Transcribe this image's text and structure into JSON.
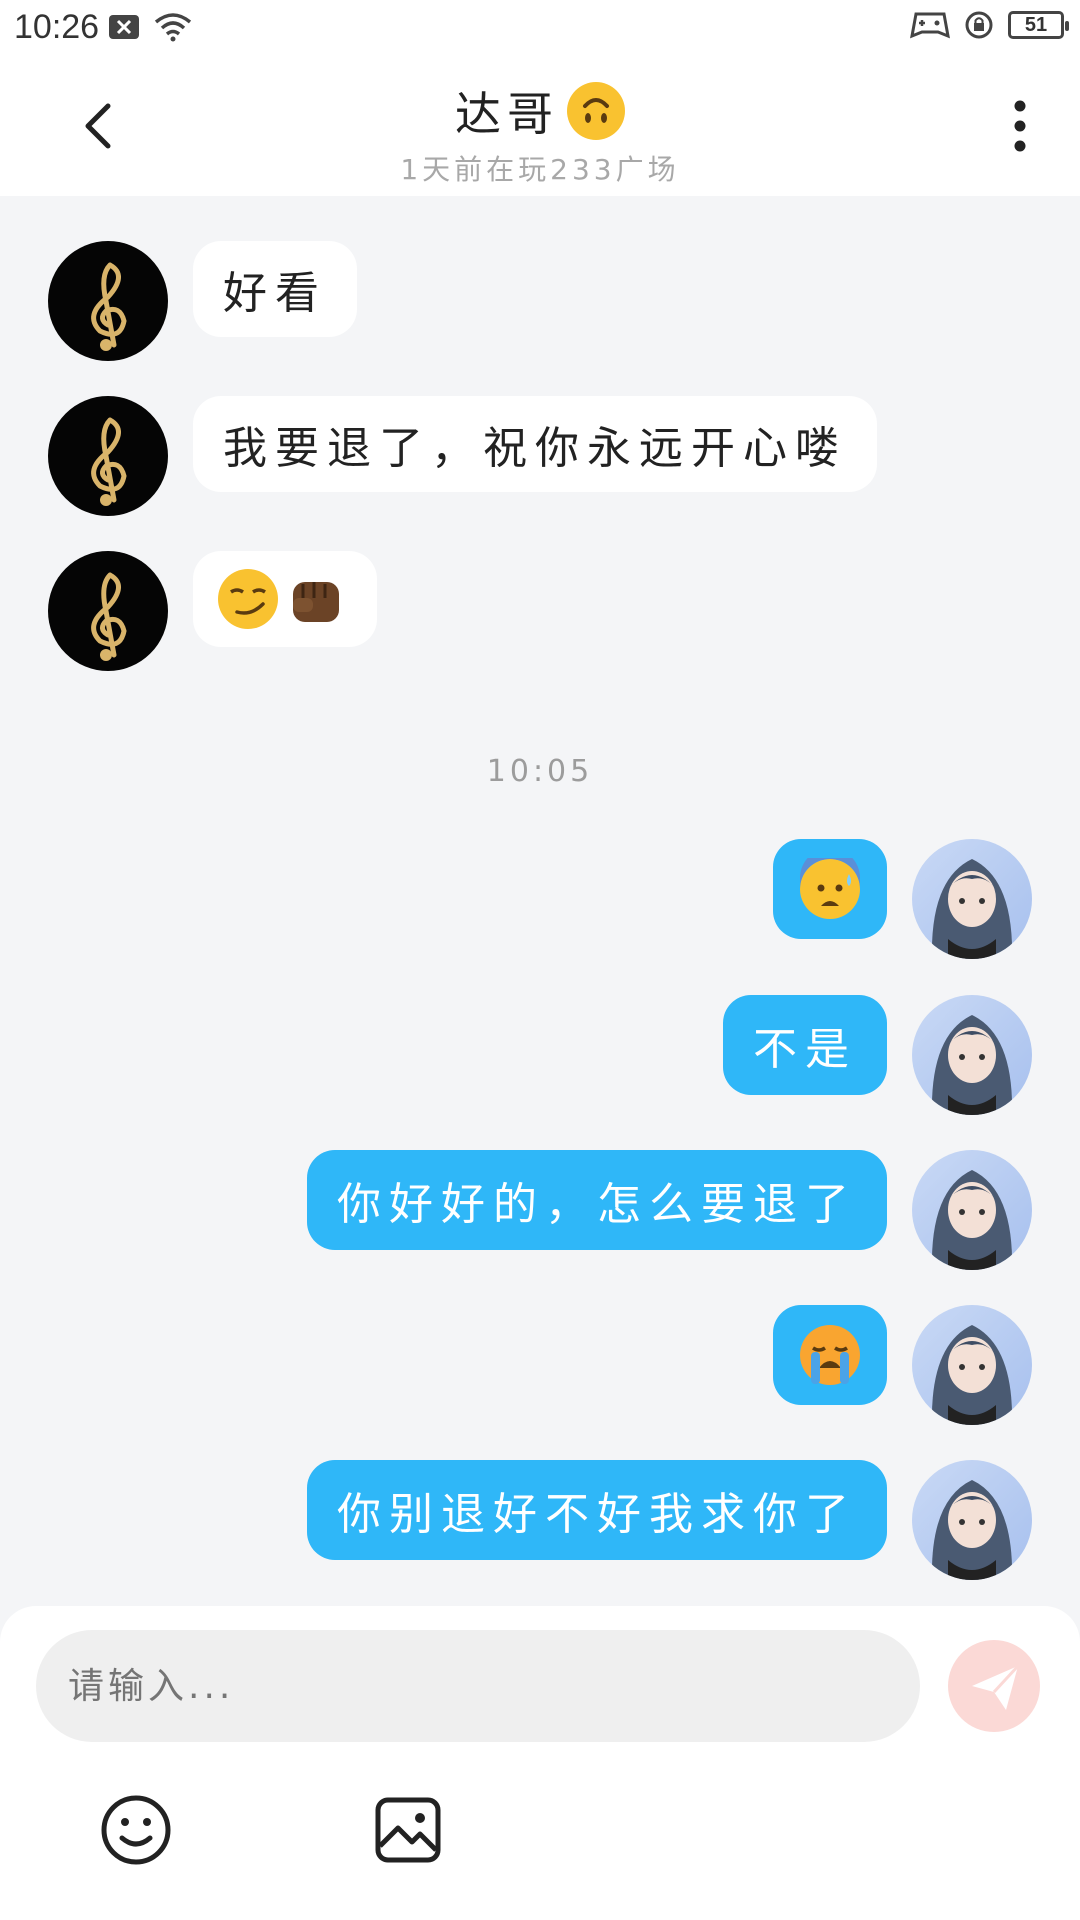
{
  "status_bar": {
    "time": "10:26",
    "battery": "51"
  },
  "header": {
    "title": "达哥",
    "subtitle": "1天前在玩233广场"
  },
  "messages": [
    {
      "side": "in",
      "text": "好看"
    },
    {
      "side": "in",
      "text": "我要退了，祝你永远开心喽"
    },
    {
      "side": "in",
      "emoji": [
        "smirk-face-emoji",
        "fist-emoji"
      ]
    },
    {
      "side": "out",
      "emoji": [
        "anxious-sweat-face-emoji"
      ]
    },
    {
      "side": "out",
      "text": "不是"
    },
    {
      "side": "out",
      "text": "你好好的，怎么要退了"
    },
    {
      "side": "out",
      "emoji": [
        "loudly-crying-face-emoji"
      ]
    },
    {
      "side": "out",
      "text": "你别退好不好我求你了"
    }
  ],
  "timestamp": "10:05",
  "composer": {
    "placeholder": "请输入..."
  },
  "colors": {
    "accent": "#2fb7f8",
    "send_disabled": "#fbd9d6",
    "background": "#f4f5f7"
  }
}
